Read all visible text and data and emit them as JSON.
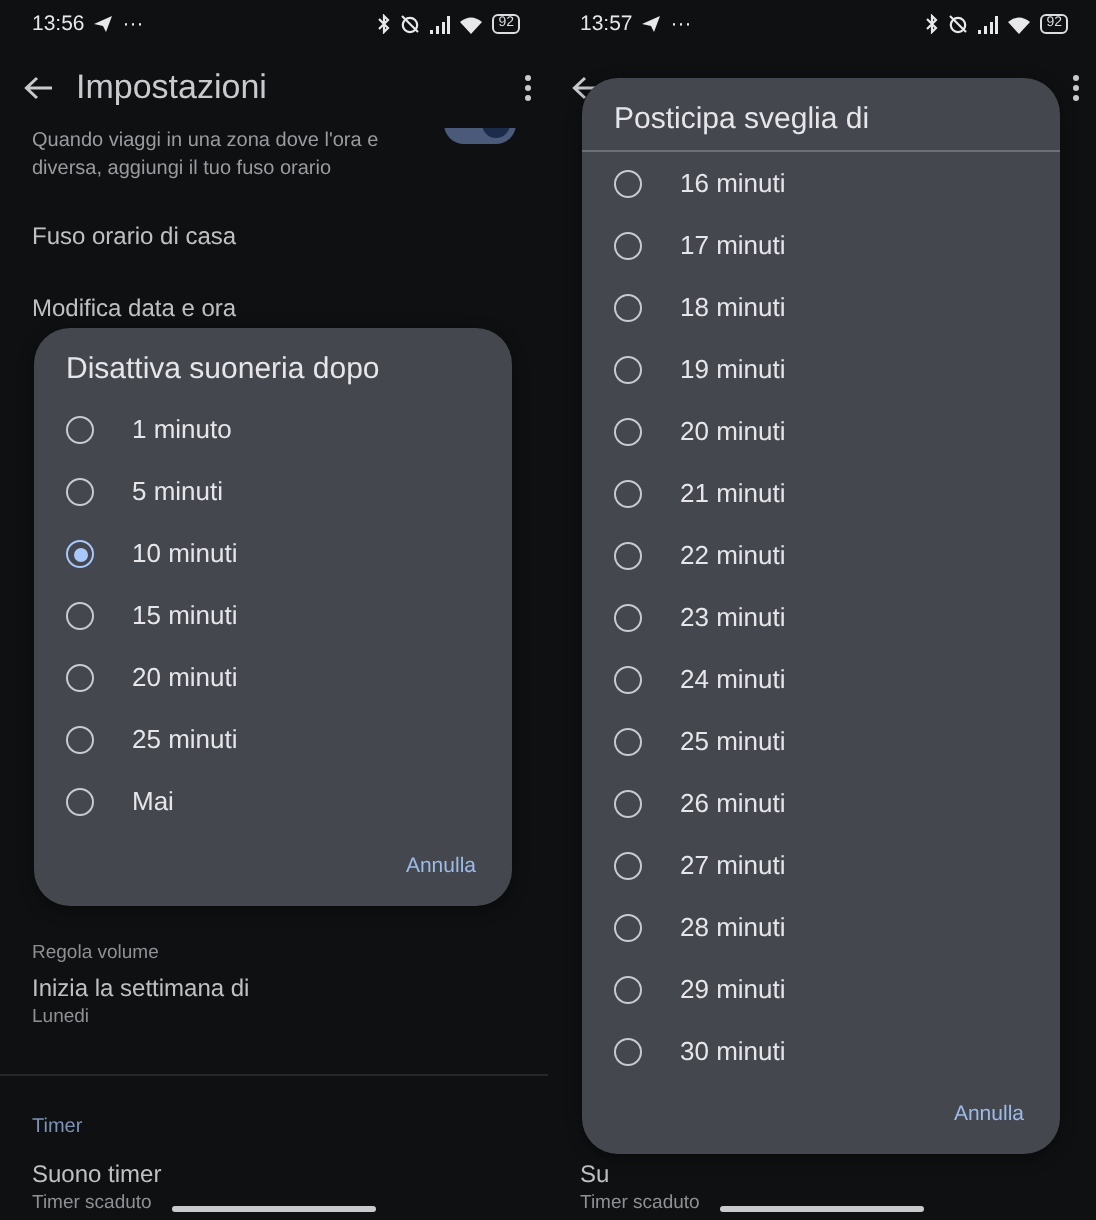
{
  "screens": [
    {
      "status_bar": {
        "time": "13:56",
        "overflow": "···",
        "battery": "92"
      },
      "app_bar": {
        "title": "Impostazioni"
      },
      "top_rows": [
        {
          "kind": "toggle",
          "subtitle": "Quando viaggi in una zona dove l'ora e diversa, aggiungi il tuo fuso orario",
          "on": true
        },
        {
          "kind": "row",
          "title": "Fuso orario di casa"
        },
        {
          "kind": "row",
          "title": "Modifica data e ora"
        }
      ],
      "bottom_rows": [
        {
          "kind": "row",
          "subtitle": "Regola volume"
        },
        {
          "kind": "row",
          "title": "Inizia la settimana di",
          "subtitle": "Lunedi"
        },
        {
          "kind": "divider"
        },
        {
          "kind": "header",
          "title": "Timer"
        },
        {
          "kind": "row",
          "title": "Suono timer",
          "subtitle": "Timer scaduto"
        }
      ],
      "dialog": {
        "title": "Disattiva suoneria dopo",
        "divider": false,
        "options": [
          {
            "label": "1 minuto",
            "selected": false
          },
          {
            "label": "5 minuti",
            "selected": false
          },
          {
            "label": "10 minuti",
            "selected": true
          },
          {
            "label": "15 minuti",
            "selected": false
          },
          {
            "label": "20 minuti",
            "selected": false
          },
          {
            "label": "25 minuti",
            "selected": false
          },
          {
            "label": "Mai",
            "selected": false
          }
        ],
        "cancel": "Annulla"
      }
    },
    {
      "status_bar": {
        "time": "13:57",
        "overflow": "···",
        "battery": "92"
      },
      "bottom_rows": [
        {
          "kind": "row",
          "title": "Su",
          "subtitle": "Timer scaduto"
        }
      ],
      "dialog": {
        "title": "Posticipa sveglia di",
        "divider": true,
        "options": [
          {
            "label": "16 minuti",
            "selected": false
          },
          {
            "label": "17 minuti",
            "selected": false
          },
          {
            "label": "18 minuti",
            "selected": false
          },
          {
            "label": "19 minuti",
            "selected": false
          },
          {
            "label": "20 minuti",
            "selected": false
          },
          {
            "label": "21 minuti",
            "selected": false
          },
          {
            "label": "22 minuti",
            "selected": false
          },
          {
            "label": "23 minuti",
            "selected": false
          },
          {
            "label": "24 minuti",
            "selected": false
          },
          {
            "label": "25 minuti",
            "selected": false
          },
          {
            "label": "26 minuti",
            "selected": false
          },
          {
            "label": "27 minuti",
            "selected": false
          },
          {
            "label": "28 minuti",
            "selected": false
          },
          {
            "label": "29 minuti",
            "selected": false
          },
          {
            "label": "30 minuti",
            "selected": false
          }
        ],
        "cancel": "Annulla"
      }
    }
  ]
}
